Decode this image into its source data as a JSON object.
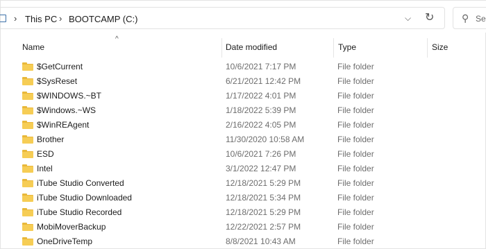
{
  "breadcrumb": {
    "root": "This PC",
    "drive": "BOOTCAMP (C:)"
  },
  "search": {
    "placeholder": "Se"
  },
  "columns": {
    "name": "Name",
    "date": "Date modified",
    "type": "Type",
    "size": "Size"
  },
  "rows": [
    {
      "name": "$GetCurrent",
      "date": "10/6/2021 7:17 PM",
      "type": "File folder"
    },
    {
      "name": "$SysReset",
      "date": "6/21/2021 12:42 PM",
      "type": "File folder"
    },
    {
      "name": "$WINDOWS.~BT",
      "date": "1/17/2022 4:01 PM",
      "type": "File folder"
    },
    {
      "name": "$Windows.~WS",
      "date": "1/18/2022 5:39 PM",
      "type": "File folder"
    },
    {
      "name": "$WinREAgent",
      "date": "2/16/2022 4:05 PM",
      "type": "File folder"
    },
    {
      "name": "Brother",
      "date": "11/30/2020 10:58 AM",
      "type": "File folder"
    },
    {
      "name": "ESD",
      "date": "10/6/2021 7:26 PM",
      "type": "File folder"
    },
    {
      "name": "Intel",
      "date": "3/1/2022 12:47 PM",
      "type": "File folder"
    },
    {
      "name": "iTube Studio Converted",
      "date": "12/18/2021 5:29 PM",
      "type": "File folder"
    },
    {
      "name": "iTube Studio Downloaded",
      "date": "12/18/2021 5:34 PM",
      "type": "File folder"
    },
    {
      "name": "iTube Studio Recorded",
      "date": "12/18/2021 5:29 PM",
      "type": "File folder"
    },
    {
      "name": "MobiMoverBackup",
      "date": "12/22/2021 2:57 PM",
      "type": "File folder"
    },
    {
      "name": "OneDriveTemp",
      "date": "8/8/2021 10:43 AM",
      "type": "File folder"
    }
  ],
  "colors": {
    "folder": "#f6cd55",
    "folder_tab": "#e8b93a",
    "meta_text": "#6d6d6d"
  },
  "icons": {
    "pc": "pc-icon",
    "folder": "folder-icon",
    "search": "search-icon",
    "refresh": "refresh-icon",
    "dropdown": "chevron-down-icon",
    "sort": "sort-up-icon"
  }
}
